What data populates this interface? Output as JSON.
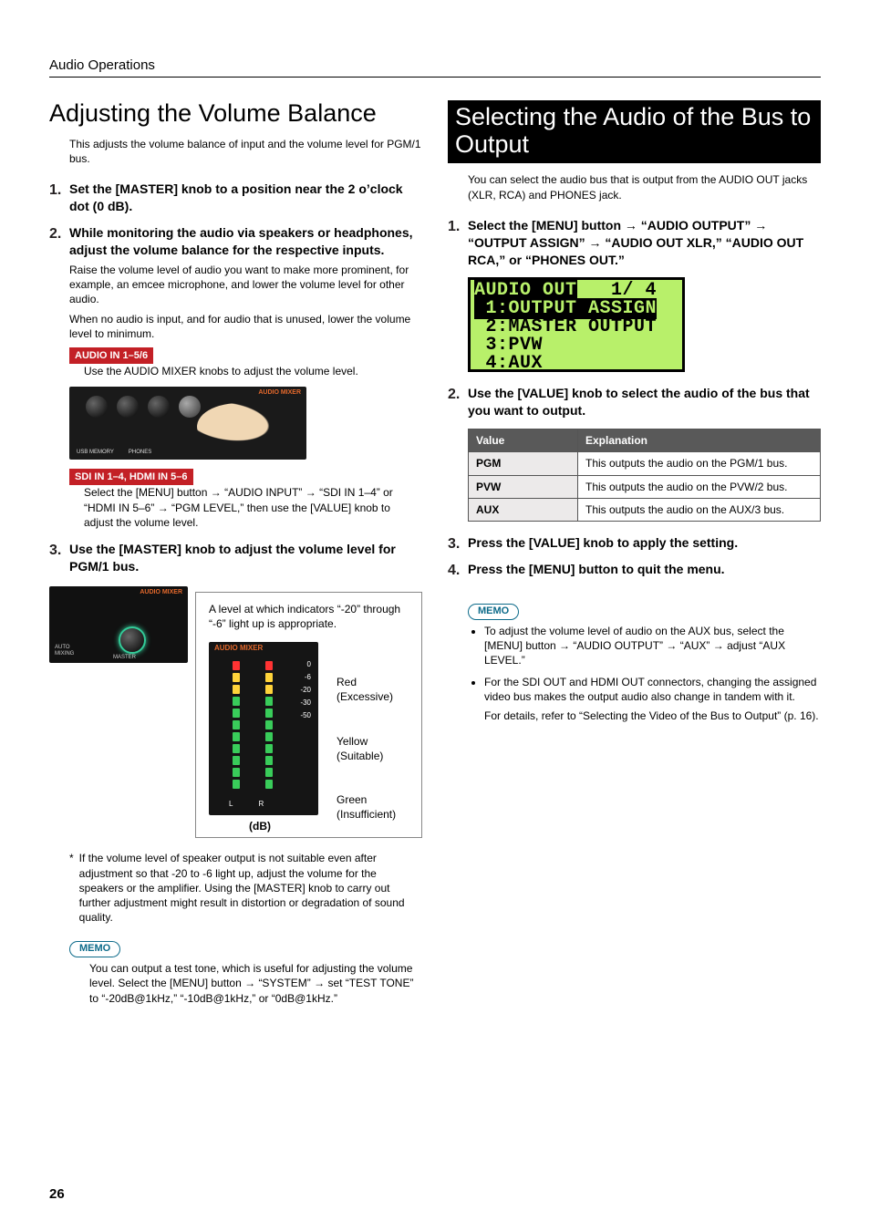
{
  "header": {
    "section": "Audio Operations"
  },
  "page_number": "26",
  "left": {
    "title": "Adjusting the Volume Balance",
    "intro": "This adjusts the volume balance of input and the volume level for PGM/1 bus.",
    "steps": {
      "s1_num": "1.",
      "s1": "Set the [MASTER] knob to a position near the 2 o’clock dot (0 dB).",
      "s2_num": "2.",
      "s2": "While monitoring the audio via speakers or headphones, adjust the volume balance for the respective inputs.",
      "s2_p1": "Raise the volume level of audio you want to make more prominent, for example, an emcee microphone, and lower the volume level for other audio.",
      "s2_p2": "When no audio is input, and for audio that is unused, lower the volume level to minimum.",
      "chip_a": "AUDIO IN 1–5/6",
      "chip_a_txt": "Use the AUDIO MIXER knobs to adjust the volume level.",
      "chip_b": "SDI IN 1–4, HDMI IN 5–6",
      "chip_b_txt_pre": "Select the [MENU] button ",
      "chip_b_txt_mid1": " “AUDIO INPUT” ",
      "chip_b_txt_mid2": " “SDI IN 1–4” or “HDMI IN 5–6” ",
      "chip_b_txt_mid3": " “PGM LEVEL,” then use the [VALUE] knob to adjust the volume level.",
      "s3_num": "3.",
      "s3": "Use the [MASTER] knob to adjust the volume level for PGM/1 bus.",
      "level_caption": "A level at which indicators “-20” through “-6” light up is appropriate.",
      "level_red": "Red (Excessive)",
      "level_yellow": "Yellow (Suitable)",
      "level_green": "Green (Insufficient)",
      "level_db": "(dB)",
      "illus_label_audio_mixer": "AUDIO MIXER",
      "illus_label_usb": "USB MEMORY",
      "illus_label_phones": "PHONES",
      "illus_label_auto": "AUTO\nMIXING",
      "illus_label_master": "MASTER",
      "footnote_star": "*",
      "footnote": "If the volume level of speaker output is not suitable even after adjustment so that -20 to -6 light up, adjust the volume for the speakers or the amplifier. Using the [MASTER] knob to carry out further adjustment might result in distortion or degradation of sound quality.",
      "memo_label": "MEMO",
      "memo_txt_pre": "You can output a test tone, which is useful for adjusting the volume level. Select the [MENU] button ",
      "memo_txt_mid": " “SYSTEM” ",
      "memo_txt_end": " set “TEST TONE” to “-20dB@1kHz,” “-10dB@1kHz,” or “0dB@1kHz.”"
    }
  },
  "right": {
    "title": "Selecting the Audio of the Bus to Output",
    "intro": "You can select the audio bus that is output from the AUDIO OUT jacks (XLR, RCA) and PHONES jack.",
    "s1_num": "1.",
    "s1_pre": "Select the [MENU] button ",
    "s1_mid1": " “AUDIO OUTPUT” ",
    "s1_mid2": " “OUTPUT ASSIGN” ",
    "s1_end": " “AUDIO OUT XLR,” “AUDIO OUT RCA,” or “PHONES OUT.”",
    "lcd": {
      "r1a": "AUDIO OUT",
      "r1b": "   1/ 4",
      "r2": " 1:OUTPUT ASSIGN",
      "r3": " 2:MASTER OUTPUT",
      "r4": " 3:PVW",
      "r5": " 4:AUX"
    },
    "s2_num": "2.",
    "s2": "Use the [VALUE] knob to select the audio of the bus that you want to output.",
    "table": {
      "h1": "Value",
      "h2": "Explanation",
      "rows": [
        {
          "v": "PGM",
          "e": "This outputs the audio on the PGM/1 bus."
        },
        {
          "v": "PVW",
          "e": "This outputs the audio on the PVW/2 bus."
        },
        {
          "v": "AUX",
          "e": "This outputs the audio on the AUX/3 bus."
        }
      ]
    },
    "s3_num": "3.",
    "s3": "Press the [VALUE] knob to apply the setting.",
    "s4_num": "4.",
    "s4": "Press the [MENU] button to quit the menu.",
    "memo_label": "MEMO",
    "memo1_pre": "To adjust the volume level of audio on the AUX bus, select the [MENU] button ",
    "memo1_mid1": " “AUDIO OUTPUT” ",
    "memo1_mid2": " “AUX” ",
    "memo1_end": " adjust “AUX LEVEL.”",
    "memo2a": "For the SDI OUT and HDMI OUT connectors, changing the assigned video bus makes the output audio also change in tandem with it.",
    "memo2b": "For details, refer to “Selecting the Video of the Bus to Output” (p. 16)."
  },
  "glyphs": {
    "arrow": "→"
  },
  "chart_data": {
    "type": "bar",
    "title": "AUDIO MIXER level meter",
    "ylabel": "dB",
    "categories": [
      "0",
      "-6",
      "-20",
      "-30",
      "-50"
    ],
    "series": [
      {
        "name": "L",
        "values": [
          0,
          -6,
          -20,
          -30,
          -50
        ]
      },
      {
        "name": "R",
        "values": [
          0,
          -6,
          -20,
          -30,
          -50
        ]
      }
    ],
    "ylim": [
      -50,
      0
    ],
    "annotations": [
      {
        "range": [
          0,
          0
        ],
        "label": "Red (Excessive)"
      },
      {
        "range": [
          -20,
          -6
        ],
        "label": "Yellow (Suitable)"
      },
      {
        "range": [
          -50,
          -30
        ],
        "label": "Green (Insufficient)"
      }
    ]
  }
}
